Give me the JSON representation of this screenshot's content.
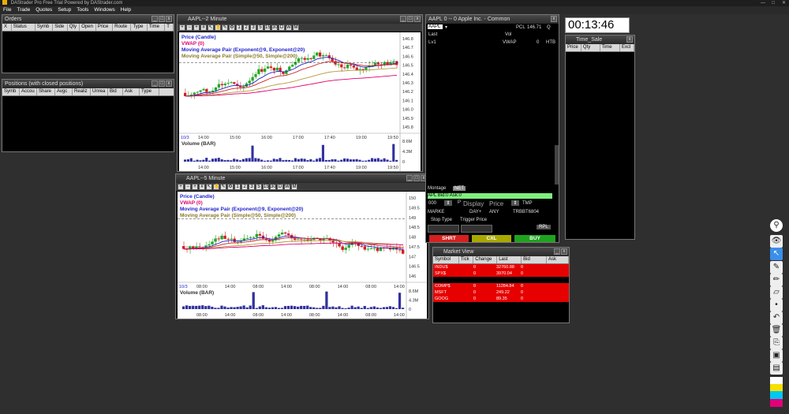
{
  "app": {
    "title": "DAStrader Pro Free Trial Powered by DAStrader.com"
  },
  "menu": [
    "File",
    "Trade",
    "Quotes",
    "Setup",
    "Tools",
    "Windows",
    "Help"
  ],
  "orders": {
    "title": "Orders",
    "columns": [
      "X",
      "Status",
      "Symb",
      "Side",
      "Qty",
      "Open",
      "Price",
      "Route",
      "Type",
      "Time",
      "T"
    ]
  },
  "positions": {
    "title": "Positions (with closed positions)",
    "columns": [
      "Symb",
      "Accou",
      "Share",
      "Avgc",
      "Realiz",
      "Unrea",
      "Bid",
      "Ask",
      "Type"
    ]
  },
  "chart1": {
    "title": "AAPL--2 Minute",
    "legend": [
      "Price (Candle)",
      "VWAP (0)",
      "Moving Average Pair (Exponent@9, Exponent@20)",
      "Moving Average Pair (Simple@50, Simple@200)"
    ],
    "price_ticks": [
      "146.8",
      "146.7",
      "146.6",
      "146.5",
      "146.4",
      "146.3",
      "146.2",
      "146.1",
      "146.0",
      "145.9",
      "145.8"
    ],
    "time_ticks": [
      "14:00",
      "15:00",
      "16:00",
      "17:00",
      "17:40",
      "19:00",
      "19:50"
    ],
    "date_label": "10/3",
    "volume_label": "Volume (BAR)",
    "volume_ticks": [
      "8.6M",
      "4.3M",
      "0"
    ]
  },
  "chart2": {
    "title": "AAPL--5 Minute",
    "legend": [
      "Price (Candle)",
      "VWAP (0)",
      "Moving Average Pair (Exponent@9, Exponent@20)",
      "Moving Average Pair (Simple@50, Simple@200)"
    ],
    "price_ticks": [
      "150",
      "149.5",
      "149",
      "148.5",
      "148",
      "147.5",
      "147",
      "146.5",
      "146"
    ],
    "time_ticks": [
      "08:00",
      "14:00",
      "08:00",
      "14:00",
      "08:00",
      "14:00",
      "08:00",
      "14:00"
    ],
    "date_label": "10/3",
    "volume_label": "Volume (BAR)",
    "volume_ticks": [
      "8.6M",
      "4.3M",
      "0"
    ]
  },
  "level2": {
    "title": "AAPL  0 -- 0  Apple Inc. - Common",
    "symbol": "AAPL",
    "pcl_label": "PCL",
    "pcl": "146.71",
    "q": "Q",
    "last": "Last",
    "vol": "Vol",
    "lv1": "Lv1",
    "vwap_label": "VWAP",
    "vwap": "0",
    "htb": "HTB"
  },
  "montage": {
    "tab1": "Montage",
    "tab2": "NET",
    "bidask": "APL Bid:0 Ask:0",
    "qty": "000",
    "route": "P",
    "display": "Display",
    "price": "Price",
    "tmp": "TMP",
    "ordtype": "MARKE",
    "tif": "DAY+",
    "venue": "ANY",
    "account": "TRBBT6804",
    "stop_type": "Stop Type",
    "trigger_price": "Trigger Price",
    "rpl": "RPL",
    "short": "SHRT",
    "cxl": "CXL",
    "buy": "BUY"
  },
  "clock": {
    "time": "00:13:46"
  },
  "timesale": {
    "title": "Time_Sale",
    "columns": [
      "Price",
      "Qty",
      "Time",
      "Excl"
    ]
  },
  "marketview": {
    "title": "Market View",
    "columns": [
      "Symbol",
      "Tick",
      "Change",
      "Last",
      "Bid",
      "Ask"
    ],
    "rows": [
      {
        "symbol": "INDU$",
        "change": "0",
        "last": "32760.88",
        "bid": "0"
      },
      {
        "symbol": "SPX$",
        "change": "0",
        "last": "3970.04",
        "bid": "0"
      },
      {
        "symbol": "",
        "change": "",
        "last": "",
        "bid": ""
      },
      {
        "symbol": "COMP$",
        "change": "0",
        "last": "11284.84",
        "bid": "0"
      },
      {
        "symbol": "MSFT",
        "change": "0",
        "last": "249.22",
        "bid": "0"
      },
      {
        "symbol": "GOOG",
        "change": "0",
        "last": "89.35",
        "bid": "0"
      }
    ]
  },
  "colors": {
    "bull": "#22aa22",
    "bear": "#cc2222",
    "vwap": "#e0006a",
    "ema": "#2222cc",
    "sma": "#b59a3a",
    "alert": "#e60000",
    "buy": "#1fa21f",
    "sell": "#d42020",
    "cancel": "#a8a800"
  }
}
